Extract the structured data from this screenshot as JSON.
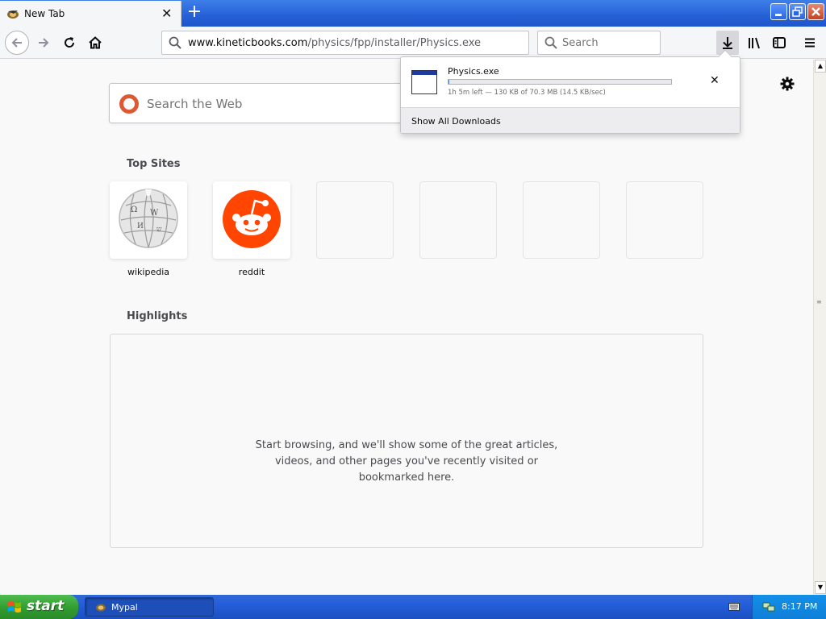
{
  "browser": {
    "tab": {
      "title": "New Tab",
      "close_glyph": "✕"
    },
    "new_tab_glyph": "+",
    "window_controls": {
      "minimize": "—",
      "maximize": "❐",
      "close": "✕"
    },
    "url": {
      "host": "www.kineticbooks.com",
      "path": "/physics/fpp/installer/Physics.exe"
    },
    "search_placeholder": "Search"
  },
  "newtab": {
    "search_placeholder": "Search the Web",
    "top_sites_title": "Top Sites",
    "top_sites": [
      {
        "label": "wikipedia"
      },
      {
        "label": "reddit"
      },
      {
        "label": ""
      },
      {
        "label": ""
      },
      {
        "label": ""
      },
      {
        "label": ""
      }
    ],
    "highlights_title": "Highlights",
    "highlights_message": [
      "Start browsing, and we'll show some of the great articles,",
      "videos, and other pages you've recently visited or",
      "bookmarked here."
    ]
  },
  "downloads_panel": {
    "filename": "Physics.exe",
    "progress": 0.0018,
    "status": "1h 5m left — 130 KB of 70.3 MB (14.5 KB/sec)",
    "cancel_glyph": "✕",
    "show_all_label": "Show All Downloads"
  },
  "taskbar": {
    "start_label": "start",
    "task_label": "Mypal",
    "clock": "8:17 PM"
  },
  "colors": {
    "accent": "#0a84ff",
    "reddit": "#ff4500",
    "duckduckgo": "#de5833",
    "xp_start_green": "#3c9e3c",
    "xp_taskbar_blue": "#245edb"
  },
  "icons": {
    "tab_favicon": "mypal-icon",
    "nav": [
      "back-arrow-icon",
      "forward-arrow-icon",
      "reload-icon",
      "home-icon"
    ],
    "toolbar": [
      "download-arrow-icon",
      "library-icon",
      "sidebar-icon",
      "hamburger-menu-icon"
    ],
    "settings": "gear-icon"
  }
}
